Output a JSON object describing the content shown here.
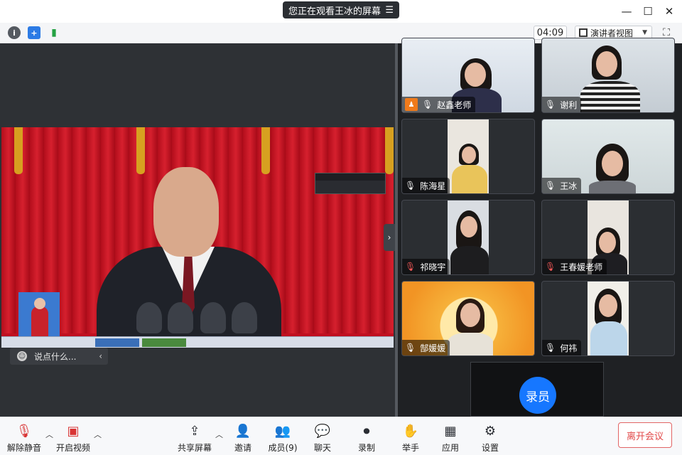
{
  "titlebar": {
    "share_notice": "您正在观看王冰的屏幕",
    "menu_icon": "list-icon",
    "window_controls": [
      "minimize-icon",
      "maximize-icon",
      "close-icon"
    ]
  },
  "toolbar": {
    "icons": [
      "info-icon",
      "shield-icon",
      "signal-icon"
    ],
    "timer": "04:09",
    "view_mode": "演讲者视图",
    "fullscreen_icon": "fullscreen-icon"
  },
  "chat": {
    "placeholder": "说点什么..."
  },
  "participants": [
    {
      "name": "赵鑫老师",
      "host": true,
      "muted": false
    },
    {
      "name": "谢利",
      "host": false,
      "muted": false
    },
    {
      "name": "陈海星",
      "host": false,
      "muted": false
    },
    {
      "name": "王冰",
      "host": false,
      "muted": false
    },
    {
      "name": "祁晓宇",
      "host": false,
      "muted": true
    },
    {
      "name": "王春媛老师",
      "host": false,
      "muted": true
    },
    {
      "name": "郜媛媛",
      "host": false,
      "muted": false
    },
    {
      "name": "何祎",
      "host": false,
      "muted": false
    }
  ],
  "recorder": {
    "label": "录员"
  },
  "bottombar": {
    "unmute": "解除静音",
    "start_video": "开启视频",
    "share_screen": "共享屏幕",
    "invite": "邀请",
    "members": "成员(9)",
    "chat": "聊天",
    "record": "录制",
    "raise_hand": "举手",
    "apps": "应用",
    "settings": "设置",
    "leave": "离开会议"
  },
  "colors": {
    "accent": "#1677ff",
    "leave": "#e24848",
    "host_badge": "#f07a1a"
  }
}
